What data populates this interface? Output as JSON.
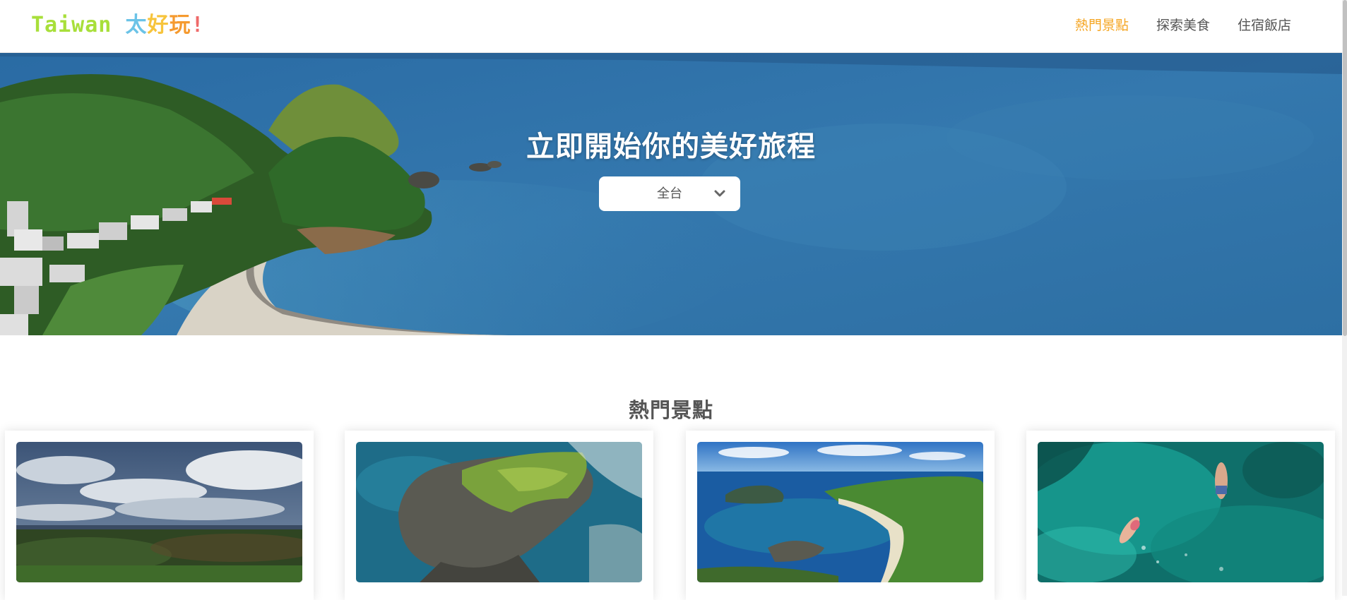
{
  "header": {
    "logo": {
      "part1": "Taiwan",
      "part2": "太",
      "part3": "好",
      "part4": "玩",
      "part5": "!"
    },
    "nav": [
      {
        "label": "熱門景點",
        "active": true
      },
      {
        "label": "探索美食",
        "active": false
      },
      {
        "label": "住宿飯店",
        "active": false
      }
    ]
  },
  "hero": {
    "title": "立即開始你的美好旅程",
    "region_select": {
      "value": "全台",
      "icon": "chevron-down-icon"
    }
  },
  "section": {
    "title": "熱門景點"
  },
  "colors": {
    "accent": "#f5a623",
    "nav_text": "#555555",
    "logo_green": "#a8df3a",
    "logo_blue": "#6bc3e7",
    "logo_yellow": "#f7c43c",
    "logo_orange": "#f59a2f",
    "logo_red": "#ef6a6a"
  }
}
